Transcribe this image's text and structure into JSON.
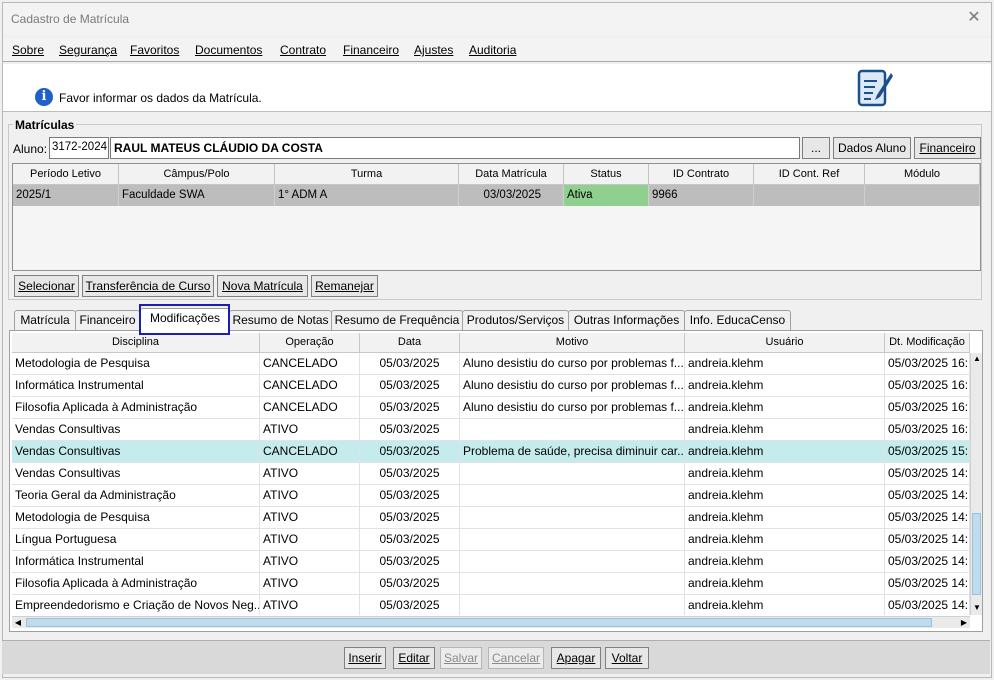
{
  "window": {
    "title": "Cadastro de Matrícula",
    "close_glyph": "✕"
  },
  "menu": [
    "Sobre",
    "Segurança",
    "Favoritos",
    "Documentos",
    "Contrato",
    "Financeiro",
    "Ajustes",
    "Auditoria"
  ],
  "info": {
    "icon": "info-icon",
    "text": "Favor informar os dados da Matrícula."
  },
  "matriculas": {
    "group_title": "Matrículas",
    "aluno_label": "Aluno:",
    "aluno_code": "3172-2024",
    "aluno_name": "RAUL MATEUS CLÁUDIO DA COSTA",
    "ellipsis_label": "...",
    "dados_aluno_label": "Dados Aluno",
    "financeiro_label": "Financeiro",
    "columns": [
      "Período Letivo",
      "Câmpus/Polo",
      "Turma",
      "Data Matrícula",
      "Status",
      "ID Contrato",
      "ID Cont. Ref",
      "Módulo"
    ],
    "rows": [
      {
        "periodo": "2025/1",
        "campus": "Faculdade SWA",
        "turma": "1° ADM A",
        "data": "03/03/2025",
        "status": "Ativa",
        "id_contrato": "9966",
        "id_ref": "",
        "modulo": ""
      }
    ],
    "status_color": "#8fd08f",
    "actions": [
      "Selecionar",
      "Transferência de Curso",
      "Nova Matrícula",
      "Remanejar"
    ]
  },
  "tabs": [
    "Matrícula",
    "Financeiro",
    "Modificações",
    "Resumo de Notas",
    "Resumo de Frequência",
    "Produtos/Serviços",
    "Outras Informações",
    "Info. EducaCenso"
  ],
  "active_tab": "Modificações",
  "modificacoes": {
    "columns": [
      "Disciplina",
      "Operação",
      "Data",
      "Motivo",
      "Usuário",
      "Dt. Modificação"
    ],
    "rows": [
      {
        "disciplina": "Metodologia de Pesquisa",
        "operacao": "CANCELADO",
        "data": "05/03/2025",
        "motivo": "Aluno desistiu do curso por problemas f...",
        "usuario": "andreia.klehm",
        "dt": "05/03/2025 16:"
      },
      {
        "disciplina": "Informática Instrumental",
        "operacao": "CANCELADO",
        "data": "05/03/2025",
        "motivo": "Aluno desistiu do curso por problemas f...",
        "usuario": "andreia.klehm",
        "dt": "05/03/2025 16:"
      },
      {
        "disciplina": "Filosofia Aplicada à Administração",
        "operacao": "CANCELADO",
        "data": "05/03/2025",
        "motivo": "Aluno desistiu do curso por problemas f...",
        "usuario": "andreia.klehm",
        "dt": "05/03/2025 16:"
      },
      {
        "disciplina": "Vendas Consultivas",
        "operacao": "ATIVO",
        "data": "05/03/2025",
        "motivo": "",
        "usuario": "andreia.klehm",
        "dt": "05/03/2025 16:"
      },
      {
        "disciplina": "Vendas Consultivas",
        "operacao": "CANCELADO",
        "data": "05/03/2025",
        "motivo": "Problema de saúde, precisa diminuir car...",
        "usuario": "andreia.klehm",
        "dt": "05/03/2025 15:"
      },
      {
        "disciplina": "Vendas Consultivas",
        "operacao": "ATIVO",
        "data": "05/03/2025",
        "motivo": "",
        "usuario": "andreia.klehm",
        "dt": "05/03/2025 14:"
      },
      {
        "disciplina": "Teoria Geral da Administração",
        "operacao": "ATIVO",
        "data": "05/03/2025",
        "motivo": "",
        "usuario": "andreia.klehm",
        "dt": "05/03/2025 14:"
      },
      {
        "disciplina": "Metodologia de Pesquisa",
        "operacao": "ATIVO",
        "data": "05/03/2025",
        "motivo": "",
        "usuario": "andreia.klehm",
        "dt": "05/03/2025 14:"
      },
      {
        "disciplina": "Língua Portuguesa",
        "operacao": "ATIVO",
        "data": "05/03/2025",
        "motivo": "",
        "usuario": "andreia.klehm",
        "dt": "05/03/2025 14:"
      },
      {
        "disciplina": "Informática Instrumental",
        "operacao": "ATIVO",
        "data": "05/03/2025",
        "motivo": "",
        "usuario": "andreia.klehm",
        "dt": "05/03/2025 14:"
      },
      {
        "disciplina": "Filosofia Aplicada à Administração",
        "operacao": "ATIVO",
        "data": "05/03/2025",
        "motivo": "",
        "usuario": "andreia.klehm",
        "dt": "05/03/2025 14:"
      },
      {
        "disciplina": "Empreendedorismo e Criação de Novos Neg...",
        "operacao": "ATIVO",
        "data": "05/03/2025",
        "motivo": "",
        "usuario": "andreia.klehm",
        "dt": "05/03/2025 14:"
      }
    ],
    "selected_row": 4,
    "selected_color": "#c5ecec"
  },
  "bottom_buttons": [
    {
      "label": "Inserir",
      "enabled": true
    },
    {
      "label": "Editar",
      "enabled": true
    },
    {
      "label": "Salvar",
      "enabled": false
    },
    {
      "label": "Cancelar",
      "enabled": false
    },
    {
      "label": "Apagar",
      "enabled": true
    },
    {
      "label": "Voltar",
      "enabled": true
    }
  ]
}
